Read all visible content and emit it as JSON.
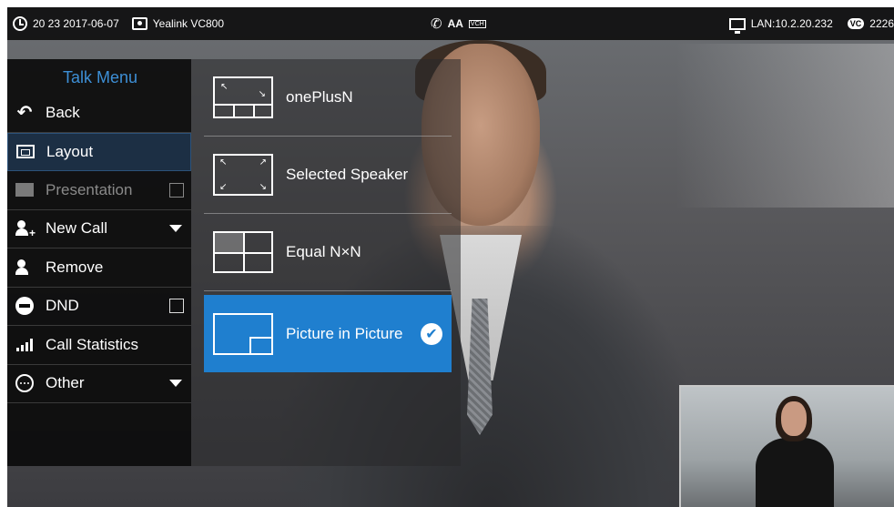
{
  "status_bar": {
    "datetime": "20 23 2017-06-07",
    "device_name": "Yealink VC800",
    "network": "LAN:10.2.20.232",
    "vc_label": "VC",
    "account": "2226",
    "center_icons": [
      "phone-icon",
      "font-size-icon",
      "vch-icon"
    ],
    "aa_label": "AA",
    "vch_label": "VCH"
  },
  "talk_menu": {
    "title": "Talk Menu",
    "items": [
      {
        "label": "Back",
        "icon": "back-icon"
      },
      {
        "label": "Layout",
        "icon": "layout-icon",
        "active": true
      },
      {
        "label": "Presentation",
        "icon": "presentation-icon",
        "disabled": true,
        "checkbox": false
      },
      {
        "label": "New Call",
        "icon": "new-call-icon",
        "dropdown": true
      },
      {
        "label": "Remove",
        "icon": "remove-icon"
      },
      {
        "label": "DND",
        "icon": "dnd-icon",
        "checkbox": false
      },
      {
        "label": "Call Statistics",
        "icon": "call-statistics-icon"
      },
      {
        "label": "Other",
        "icon": "other-icon",
        "dropdown": true
      }
    ]
  },
  "layout_panel": {
    "options": [
      {
        "label": "onePlusN",
        "selected": false
      },
      {
        "label": "Selected Speaker",
        "selected": false
      },
      {
        "label": "Equal N×N",
        "selected": false
      },
      {
        "label": "Picture in Picture",
        "selected": true
      }
    ]
  },
  "colors": {
    "accent_blue": "#1f7fcf",
    "menu_title": "#3d8fd6"
  }
}
